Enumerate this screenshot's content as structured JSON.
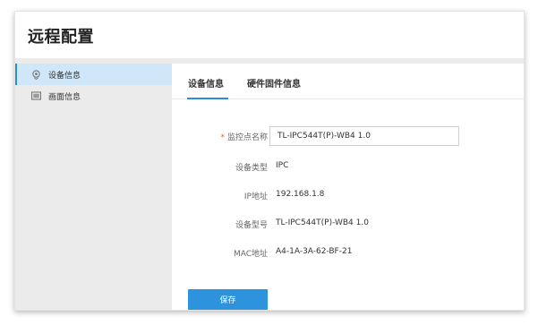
{
  "app": {
    "title": "远程配置"
  },
  "sidebar": {
    "items": [
      {
        "label": "设备信息",
        "icon": "location-pin-icon",
        "active": true
      },
      {
        "label": "画面信息",
        "icon": "display-icon",
        "active": false
      }
    ]
  },
  "tabs": [
    {
      "label": "设备信息",
      "active": true
    },
    {
      "label": "硬件固件信息",
      "active": false
    }
  ],
  "form": {
    "required_mark": "*",
    "name_label": "监控点名称",
    "name_value": "TL-IPC544T(P)-WB4 1.0",
    "device_type_label": "设备类型",
    "device_type_value": "IPC",
    "ip_label": "IP地址",
    "ip_value": "192.168.1.8",
    "model_label": "设备型号",
    "model_value": "TL-IPC544T(P)-WB4 1.0",
    "mac_label": "MAC地址",
    "mac_value": "A4-1A-3A-62-BF-21"
  },
  "actions": {
    "save_label": "保存"
  },
  "colors": {
    "accent": "#2b8fd6",
    "sidebar_bg": "#ebebeb",
    "sidebar_active_bg": "#cfe7f8",
    "required": "#e05a3a"
  }
}
